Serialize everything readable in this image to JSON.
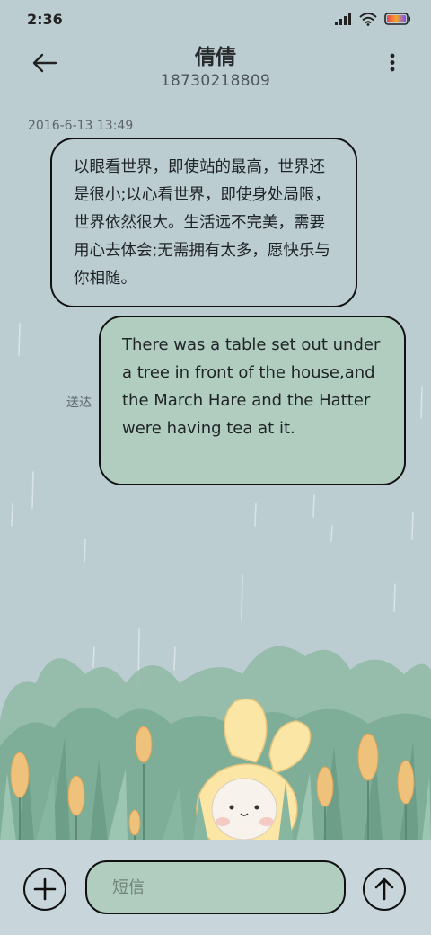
{
  "status_bar": {
    "time": "2:36"
  },
  "header": {
    "title": "倩倩",
    "phone": "18730218809"
  },
  "thread": {
    "timestamp": "2016-6-13 13:49",
    "incoming_text": "以眼看世界，即使站的最高，世界还是很小;以心看世界，即使身处局限，世界依然很大。生活远不完美，需要用心去体会;无需拥有太多，愿快乐与你相随。",
    "outgoing_text": "There was a table set out under a tree in front of the house,and the March Hare and the Hatter were having tea at it.",
    "delivered_label": "送达"
  },
  "composer": {
    "placeholder": "短信"
  },
  "icons": {
    "back": "arrow-left-icon",
    "more": "more-vertical-icon",
    "add": "plus-icon",
    "send": "arrow-up-icon",
    "signal": "signal-icon",
    "wifi": "wifi-icon",
    "battery": "battery-icon"
  },
  "colors": {
    "background": "#bccdd2",
    "outgoing_bubble": "#b1cdc0",
    "composer_bar": "#c8d5da",
    "border": "#111111"
  }
}
